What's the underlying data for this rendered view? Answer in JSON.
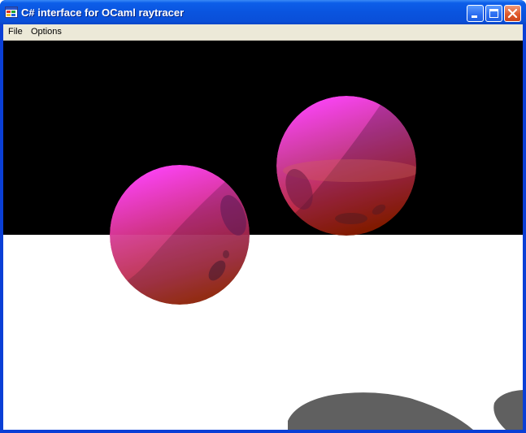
{
  "window": {
    "title": "C# interface for OCaml raytracer",
    "icon": "app-window-icon",
    "controls": [
      "minimize-icon",
      "maximize-icon",
      "close-icon"
    ]
  },
  "menu": {
    "items": [
      {
        "label": "File"
      },
      {
        "label": "Options"
      }
    ]
  },
  "render": {
    "sky_color": "#000000",
    "floor_color": "#ffffff",
    "shadow_color": "#606060",
    "sphere_top_color": "#ff44ff",
    "sphere_bottom_color": "#aa2200"
  },
  "colors": {
    "titlebar": "#0a54df",
    "menubar": "#ece9d8",
    "close_button": "#e05a2c"
  }
}
